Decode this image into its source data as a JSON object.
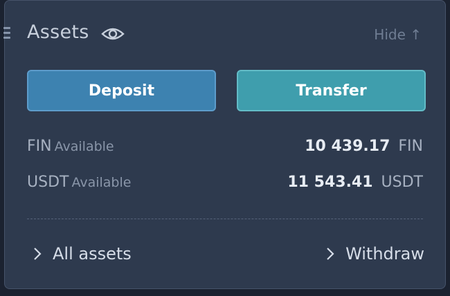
{
  "header": {
    "title": "Assets",
    "hide_label": "Hide ↑"
  },
  "actions": {
    "deposit_label": "Deposit",
    "transfer_label": "Transfer"
  },
  "balances": [
    {
      "currency": "FIN",
      "available_label": "Available",
      "amount": "10 439.17",
      "unit": "FIN"
    },
    {
      "currency": "USDT",
      "available_label": "Available",
      "amount": "11 543.41",
      "unit": "USDT"
    }
  ],
  "footer": {
    "all_assets_label": "All assets",
    "withdraw_label": "Withdraw"
  },
  "icons": {
    "drag": "drag-handle-icon",
    "eye": "eye-icon",
    "chevron": "chevron-right-icon"
  },
  "colors": {
    "panel_bg": "#2e3a4e",
    "deposit_button": "#3d82b0",
    "transfer_button": "#3f9ead"
  }
}
